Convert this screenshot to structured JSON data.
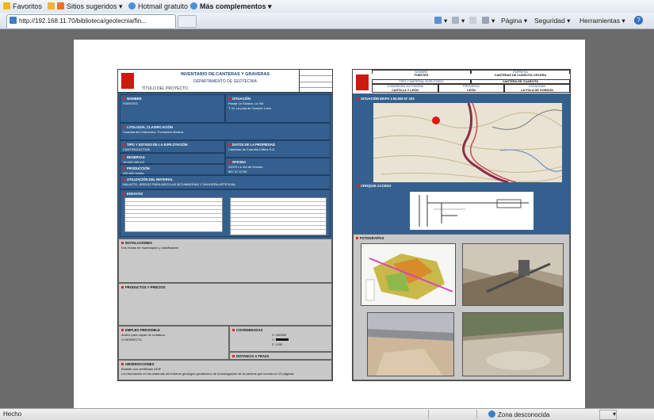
{
  "favorites_bar": {
    "favorites": "Favoritos",
    "suggested": "Sitios sugeridos ▾",
    "hotmail": "Hotmail gratuito",
    "more": "Más complementos ▾"
  },
  "tab": {
    "url": "http://192.168.11.70/biblioteca/geotecnia/fin..."
  },
  "command_bar": {
    "page": "Página ▾",
    "security": "Seguridad ▾",
    "tools": "Herramientas ▾",
    "help": "?"
  },
  "status_bar": {
    "left": "Hecho",
    "zone": "Zona desconocida",
    "zoom": "▾"
  },
  "sheet1": {
    "title": "INVENTARIO DE CANTERAS Y GRAVERAS",
    "subtitle": "DEPARTAMENTO DE GEOTECNIA",
    "project": "TÍTULO DEL PROYECTO",
    "nombre_h": "NOMBRE",
    "nombre_v": "FUENTES",
    "situacion_h": "SITUACIÓN",
    "situacion_v": "Paraje La Solana. La Vid\nT. M. La pola de Gordón. León",
    "litologia_h": "LITOLOGÍA, CLASIFICACIÓN",
    "litologia_v": "Cuarcita del Ordovícico. Formación Barrios",
    "tipo_h": "TIPO Y ESTADO DE LA EXPLOTACIÓN",
    "tipo_v": "CANTERA ACTIVA",
    "datos_h": "DATOS DE LA PROPIEDAD",
    "datos_v": "Canteras de Cuarcita Ciflera S.A.",
    "reservas_h": "RESERVAS",
    "reservas_v": "15.000.000 m3",
    "produccion_h": "PRODUCCIÓN",
    "produccion_v": "250.000 tn/año",
    "oficina_h": "OFICINA",
    "oficina_v": "24379 La Vid de Gordón\n987 57 22 50",
    "utilizacion_h": "UTILIZACIÓN DEL MATERIAL",
    "utilizacion_v": "BALASTO, ÁRIDOS PARA MEZCLAS BITUMINOSAS Y ZAHORRA ARTIFICIAL",
    "ensayos_h": "ENSAYOS",
    "instalaciones_h": "INSTALACIONES",
    "instalaciones_v": "Dos líneas de machaqueo y clasificación",
    "productos_h": "PRODUCTOS Y PRECIOS",
    "empleo_h": "EMPLEO PREVISIBLE",
    "empleo_v": "Áridos para capas de rodadura\nO INDIRECTA",
    "coordenadas_h": "COORDENADAS",
    "coord_x": "X: 280000",
    "coord_y": "Y:",
    "coord_z": "Z: 1150",
    "distancia_h": "DISTANCIA A TRAZA",
    "observaciones_h": "OBSERVACIONES",
    "observaciones_v": "Bolaste con certificado ADIF\nLa información en los sistemas del informe geológico geotécnico de homologación de la cantera que cuenta en 10 páginas"
  },
  "sheet2": {
    "h_nombre": "NOMBRE",
    "v_nombre": "FUENTES",
    "h_empresa": "EMPRESA",
    "v_empresa": "CANTERAS DE CUARCITA CIFLERA",
    "h_tipo": "TIPO Y MATERIAL EXPLOTADO",
    "v_tipo": "CANTERA DE CUARCITA",
    "h_comunidad": "COMUNIDAD AUTÓNOMA",
    "v_comunidad": "CASTILLA Y LEÓN",
    "h_provincia": "PROVINCIA",
    "v_provincia": "LEÓN",
    "h_localidad": "LOCALIDAD",
    "v_localidad": "LA POLA DE GORDÓN",
    "situacion_mapa": "SITUACIÓN MAPA 1:50.000 Nº 103",
    "croquis": "CROQUIS ACCESO",
    "fotografias": "FOTOGRAFÍAS"
  },
  "colors": {
    "sheet_blue": "#34608f",
    "logo_red": "#cc1a10"
  }
}
